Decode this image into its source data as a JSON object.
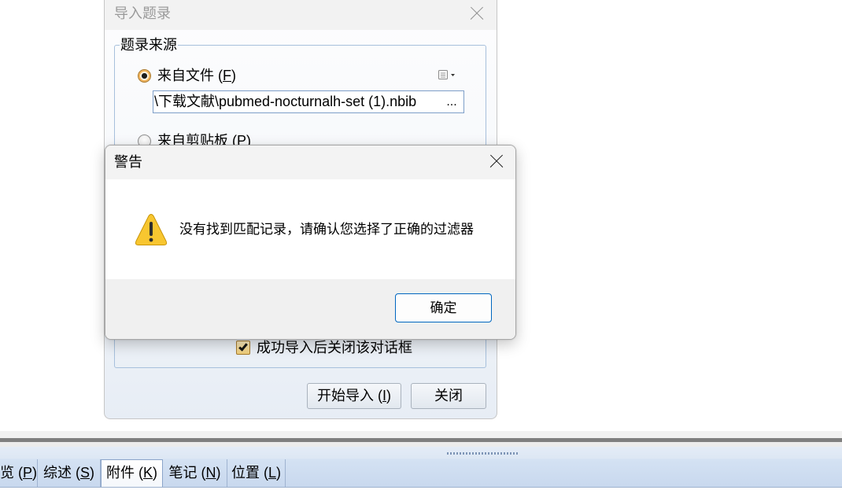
{
  "colors": {
    "accent": "#0067c0",
    "warning_fill": "#f8c630",
    "group_border": "#a7c0dc",
    "tab_bar": "#d4e2f3"
  },
  "import_dialog": {
    "title": "导入题录",
    "close_icon": "close-icon",
    "source_group": {
      "label": "题录来源",
      "from_file": {
        "label": "来自文件 (F)",
        "key": "F",
        "selected": true
      },
      "menu_icon": "document-dropdown-icon",
      "file_path": {
        "value": "\\下载文献\\pubmed-nocturnalh-set (1).nbib",
        "browse_label": "..."
      },
      "from_clipboard": {
        "label": "来自剪贴板 (P)",
        "key": "P",
        "selected": false
      }
    },
    "close_on_success": {
      "label": "成功导入后关闭该对话框",
      "checked": true,
      "check_icon": "check-icon"
    },
    "start_button": {
      "label": "开始导入 (I)",
      "key": "I"
    },
    "close_button": {
      "label": "关闭"
    }
  },
  "warning_dialog": {
    "title": "警告",
    "close_icon": "close-icon",
    "icon": "warning-icon",
    "message": "没有找到匹配记录，请确认您选择了正确的过滤器",
    "ok_label": "确定"
  },
  "detail_panel": {
    "grip_icon": "splitter-grip-icon",
    "tabs": [
      {
        "label": "览 (P)",
        "key": "P",
        "selected": false
      },
      {
        "label": "综述 (S)",
        "key": "S",
        "selected": false
      },
      {
        "label": "附件 (K)",
        "key": "K",
        "selected": true
      },
      {
        "label": "笔记 (N)",
        "key": "N",
        "selected": false
      },
      {
        "label": "位置 (L)",
        "key": "L",
        "selected": false
      }
    ]
  }
}
